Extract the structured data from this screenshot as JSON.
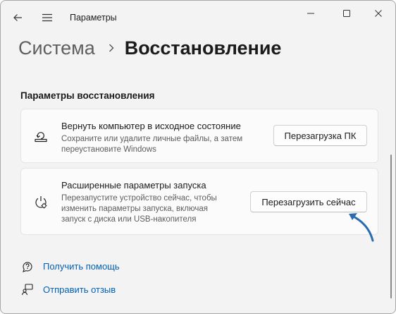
{
  "window": {
    "title": "Параметры"
  },
  "breadcrumb": {
    "parent": "Система",
    "current": "Восстановление"
  },
  "section": {
    "title": "Параметры восстановления"
  },
  "cards": [
    {
      "title": "Вернуть компьютер в исходное состояние",
      "desc_line1": "Сохраните или удалите личные файлы, а затем",
      "desc_line2": "переустановите Windows",
      "button": "Перезагрузка ПК",
      "icon": "reset-pc-icon"
    },
    {
      "title": "Расширенные параметры запуска",
      "desc_line1": "Перезапустите устройство сейчас, чтобы",
      "desc_line2": "изменить параметры запуска, включая",
      "desc_line3": "запуск с диска или USB-накопителя",
      "button": "Перезагрузить сейчас",
      "icon": "advanced-startup-icon"
    }
  ],
  "links": [
    {
      "label": "Получить помощь",
      "icon": "help-icon"
    },
    {
      "label": "Отправить отзыв",
      "icon": "feedback-icon"
    }
  ],
  "colors": {
    "accent": "#0061b5",
    "annotation_arrow": "#2b6cb0"
  }
}
